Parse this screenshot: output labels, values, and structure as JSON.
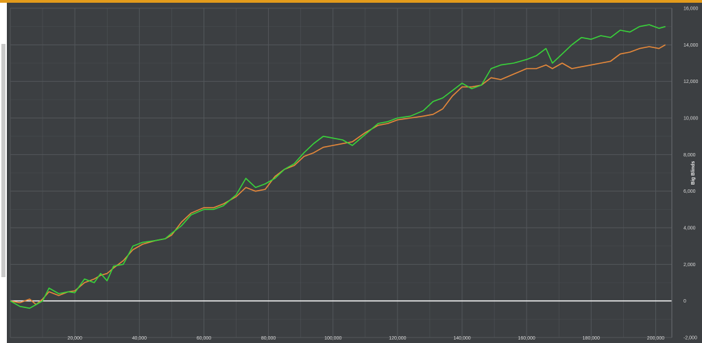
{
  "colors": {
    "background": "#3c3f42",
    "grid": "#53575b",
    "accent_bar": "#e39b1b",
    "zero_line": "#ffffff",
    "series_green": "#39d43a",
    "series_orange": "#e8893a"
  },
  "chart_data": {
    "type": "line",
    "title": "",
    "xlabel": "",
    "ylabel": "Big Blinds",
    "xlim": [
      0,
      205000
    ],
    "ylim": [
      -2000,
      16000
    ],
    "grid": true,
    "x_ticks": [
      20000,
      40000,
      60000,
      80000,
      100000,
      120000,
      140000,
      160000,
      180000,
      200000
    ],
    "x_tick_labels": [
      "20,000",
      "40,000",
      "60,000",
      "80,000",
      "100,000",
      "120,000",
      "140,000",
      "160,000",
      "180,000",
      "200,000"
    ],
    "y_ticks": [
      -2000,
      0,
      2000,
      4000,
      6000,
      8000,
      10000,
      12000,
      14000,
      16000
    ],
    "y_tick_labels": [
      "-2,000",
      "0",
      "2,000",
      "4,000",
      "6,000",
      "8,000",
      "10,000",
      "12,000",
      "14,000",
      "16,000"
    ],
    "reference_line": 0,
    "series": [
      {
        "color": "#39d43a",
        "points": [
          [
            0,
            0
          ],
          [
            3000,
            -300
          ],
          [
            6000,
            -400
          ],
          [
            8000,
            -200
          ],
          [
            10000,
            0
          ],
          [
            12000,
            700
          ],
          [
            15000,
            400
          ],
          [
            18000,
            500
          ],
          [
            20000,
            450
          ],
          [
            23000,
            1200
          ],
          [
            26000,
            1000
          ],
          [
            28000,
            1500
          ],
          [
            30000,
            1100
          ],
          [
            32000,
            1900
          ],
          [
            35000,
            2000
          ],
          [
            38000,
            3000
          ],
          [
            41000,
            3200
          ],
          [
            45000,
            3300
          ],
          [
            48000,
            3400
          ],
          [
            50000,
            3700
          ],
          [
            53000,
            4100
          ],
          [
            56000,
            4700
          ],
          [
            60000,
            5000
          ],
          [
            63000,
            5000
          ],
          [
            66000,
            5200
          ],
          [
            70000,
            5800
          ],
          [
            73000,
            6700
          ],
          [
            76000,
            6200
          ],
          [
            79000,
            6400
          ],
          [
            82000,
            6700
          ],
          [
            85000,
            7200
          ],
          [
            88000,
            7500
          ],
          [
            91000,
            8100
          ],
          [
            94000,
            8600
          ],
          [
            97000,
            9000
          ],
          [
            100000,
            8900
          ],
          [
            103000,
            8800
          ],
          [
            106000,
            8500
          ],
          [
            110000,
            9100
          ],
          [
            114000,
            9700
          ],
          [
            117000,
            9800
          ],
          [
            120000,
            10000
          ],
          [
            124000,
            10100
          ],
          [
            128000,
            10400
          ],
          [
            131000,
            10900
          ],
          [
            134000,
            11100
          ],
          [
            137000,
            11500
          ],
          [
            140000,
            11900
          ],
          [
            143000,
            11600
          ],
          [
            146000,
            11800
          ],
          [
            149000,
            12700
          ],
          [
            152000,
            12900
          ],
          [
            156000,
            13000
          ],
          [
            160000,
            13200
          ],
          [
            163000,
            13400
          ],
          [
            166000,
            13800
          ],
          [
            168000,
            13000
          ],
          [
            171000,
            13500
          ],
          [
            174000,
            14000
          ],
          [
            177000,
            14400
          ],
          [
            180000,
            14300
          ],
          [
            183000,
            14500
          ],
          [
            186000,
            14400
          ],
          [
            189000,
            14800
          ],
          [
            192000,
            14700
          ],
          [
            195000,
            15000
          ],
          [
            198000,
            15100
          ],
          [
            201000,
            14900
          ],
          [
            203000,
            15000
          ]
        ]
      },
      {
        "color": "#e8893a",
        "points": [
          [
            0,
            0
          ],
          [
            3000,
            -100
          ],
          [
            6000,
            100
          ],
          [
            8000,
            -200
          ],
          [
            10000,
            100
          ],
          [
            12000,
            500
          ],
          [
            15000,
            300
          ],
          [
            18000,
            500
          ],
          [
            20000,
            550
          ],
          [
            23000,
            1000
          ],
          [
            26000,
            1200
          ],
          [
            28000,
            1400
          ],
          [
            30000,
            1500
          ],
          [
            32000,
            1800
          ],
          [
            35000,
            2200
          ],
          [
            38000,
            2800
          ],
          [
            41000,
            3100
          ],
          [
            45000,
            3300
          ],
          [
            48000,
            3400
          ],
          [
            50000,
            3600
          ],
          [
            53000,
            4300
          ],
          [
            56000,
            4800
          ],
          [
            60000,
            5100
          ],
          [
            63000,
            5100
          ],
          [
            66000,
            5300
          ],
          [
            70000,
            5700
          ],
          [
            73000,
            6200
          ],
          [
            76000,
            6000
          ],
          [
            79000,
            6100
          ],
          [
            82000,
            6800
          ],
          [
            85000,
            7200
          ],
          [
            88000,
            7400
          ],
          [
            91000,
            7900
          ],
          [
            94000,
            8100
          ],
          [
            97000,
            8400
          ],
          [
            100000,
            8500
          ],
          [
            103000,
            8600
          ],
          [
            106000,
            8700
          ],
          [
            110000,
            9200
          ],
          [
            114000,
            9600
          ],
          [
            117000,
            9700
          ],
          [
            120000,
            9900
          ],
          [
            124000,
            10000
          ],
          [
            128000,
            10100
          ],
          [
            131000,
            10200
          ],
          [
            134000,
            10500
          ],
          [
            137000,
            11200
          ],
          [
            140000,
            11700
          ],
          [
            143000,
            11700
          ],
          [
            146000,
            11800
          ],
          [
            149000,
            12200
          ],
          [
            152000,
            12100
          ],
          [
            156000,
            12400
          ],
          [
            160000,
            12700
          ],
          [
            163000,
            12700
          ],
          [
            166000,
            12900
          ],
          [
            168000,
            12700
          ],
          [
            171000,
            13000
          ],
          [
            174000,
            12700
          ],
          [
            177000,
            12800
          ],
          [
            180000,
            12900
          ],
          [
            183000,
            13000
          ],
          [
            186000,
            13100
          ],
          [
            189000,
            13500
          ],
          [
            192000,
            13600
          ],
          [
            195000,
            13800
          ],
          [
            198000,
            13900
          ],
          [
            201000,
            13800
          ],
          [
            203000,
            14000
          ]
        ]
      }
    ]
  }
}
